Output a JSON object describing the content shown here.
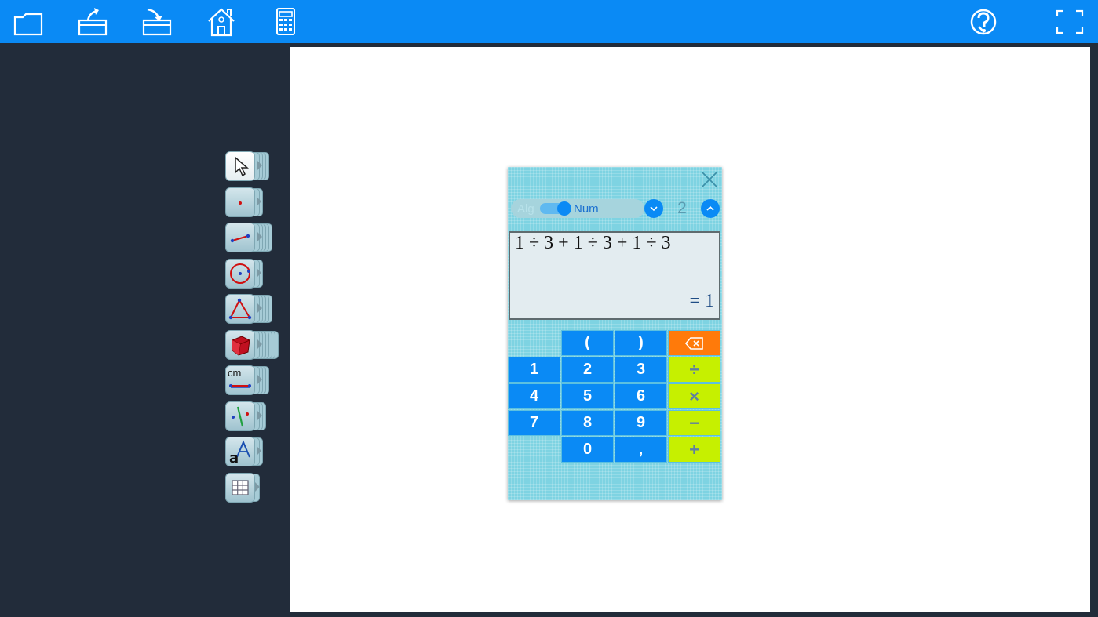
{
  "toolbar": {
    "icons": [
      "new-file-icon",
      "open-file-icon",
      "save-file-icon",
      "home-icon",
      "calculator-icon",
      "help-icon",
      "fullscreen-icon"
    ]
  },
  "tools": [
    "pointer-tool-icon",
    "point-tool-icon",
    "segment-tool-icon",
    "circle-tool-icon",
    "triangle-tool-icon",
    "solid-tool-icon",
    "measure-tool-icon",
    "symmetry-tool-icon",
    "text-tool-icon",
    "table-tool-icon"
  ],
  "calculator": {
    "mode_alg": "Alg",
    "mode_num": "Num",
    "precision": "2",
    "expression": "1 ÷ 3 + 1 ÷ 3 + 1 ÷ 3",
    "result": "= 1",
    "measure_label": "cm",
    "keys": {
      "lparen": "(",
      "rparen": ")",
      "k1": "1",
      "k2": "2",
      "k3": "3",
      "k4": "4",
      "k5": "5",
      "k6": "6",
      "k7": "7",
      "k8": "8",
      "k9": "9",
      "k0": "0",
      "comma": ",",
      "div": "÷",
      "mul": "×",
      "sub": "−",
      "add": "+"
    }
  },
  "colors": {
    "accent": "#0a8af5",
    "sidebar": "#222c3a",
    "calc_bg": "#7ed3e2",
    "op_key": "#c6f000",
    "delete_key": "#ff7a0a"
  }
}
